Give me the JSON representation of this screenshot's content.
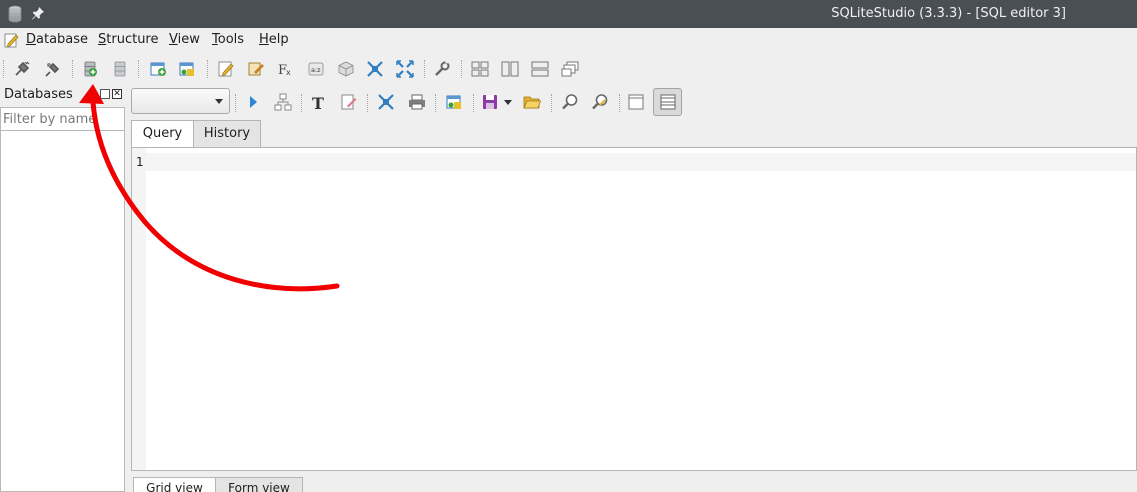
{
  "window": {
    "title": "SQLiteStudio (3.3.3) - [SQL editor 3]"
  },
  "menu": {
    "items": [
      {
        "label": "Database",
        "mnemonic": "D",
        "rest": "atabase"
      },
      {
        "label": "Structure",
        "mnemonic": "S",
        "rest": "tructure"
      },
      {
        "label": "View",
        "mnemonic": "V",
        "rest": "iew"
      },
      {
        "label": "Tools",
        "mnemonic": "T",
        "rest": "ools"
      },
      {
        "label": "Help",
        "mnemonic": "H",
        "rest": "elp"
      }
    ]
  },
  "databases": {
    "title": "Databases",
    "filter_placeholder": "Filter by name"
  },
  "editor": {
    "tabs": [
      "Query",
      "History"
    ],
    "line_numbers": [
      "1"
    ],
    "result_tabs": [
      "Grid view",
      "Form view"
    ]
  },
  "colors": {
    "titlebar": "#4a4f55",
    "annotation_arrow": "#f00000"
  }
}
